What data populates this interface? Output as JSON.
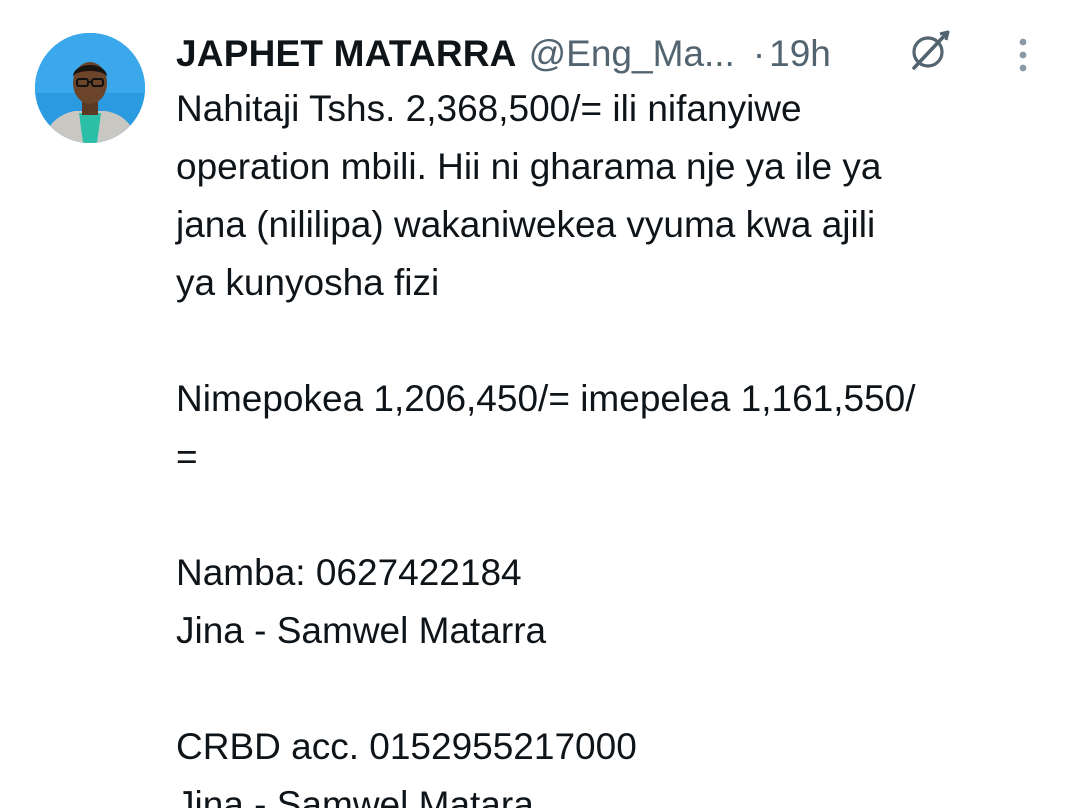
{
  "tweet": {
    "display_name": "JAPHET MATARRA",
    "handle": "@Eng_Ma...",
    "separator": "·",
    "time": "19h",
    "body": {
      "paragraph1": [
        "Nahitaji Tshs. 2,368,500/= ili nifanyiwe",
        "operation mbili. Hii ni gharama nje ya ile ya",
        "jana (nililipa) wakaniwekea vyuma kwa ajili",
        "ya kunyosha fizi"
      ],
      "paragraph2": [
        "Nimepokea 1,206,450/= imepelea 1,161,550/",
        "="
      ],
      "paragraph3": [
        "Namba: 0627422184",
        "Jina - Samwel Matarra"
      ],
      "paragraph4": [
        "CRBD acc. 0152955217000",
        "Jina - Samwel Matara"
      ]
    }
  },
  "icons": {
    "avatar": "profile-photo",
    "grok": "grok-icon",
    "more": "more-vertical-icon"
  },
  "colors": {
    "text_primary": "#0f1419",
    "text_secondary": "#536471",
    "avatar_bg": "#2a9be0"
  }
}
